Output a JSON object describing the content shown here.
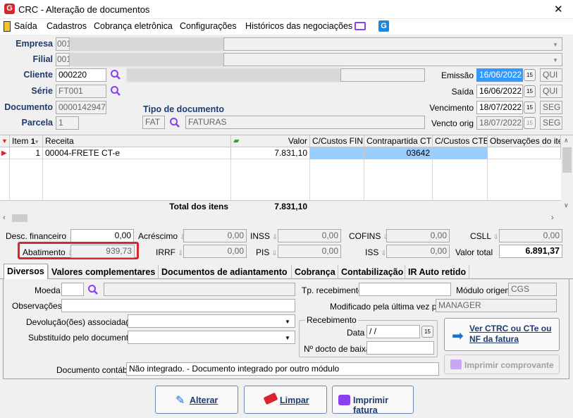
{
  "window": {
    "title": "CRC - Alteração de documentos",
    "close_glyph": "✕"
  },
  "menu": {
    "items": [
      "Saída",
      "Cadastros",
      "Cobrança eletrônica",
      "Configurações",
      "Históricos das negociações"
    ]
  },
  "header": {
    "empresa_label": "Empresa",
    "empresa_code": "001",
    "filial_label": "Filial",
    "filial_code": "001",
    "cliente_label": "Cliente",
    "cliente_code": "000220",
    "serie_label": "Série",
    "serie_value": "FT001",
    "documento_label": "Documento",
    "documento_value": "0000142947",
    "parcela_label": "Parcela",
    "parcela_value": "1",
    "tipo_label": "Tipo de documento",
    "tipo_code": "FAT",
    "tipo_desc": "FATURAS",
    "emissao_label": "Emissão",
    "emissao_date": "16/06/2022",
    "emissao_day": "QUI",
    "saida_label": "Saída",
    "saida_date": "16/06/2022",
    "saida_day": "QUI",
    "venc_label": "Vencimento",
    "venc_date": "18/07/2022",
    "venc_day": "SEG",
    "vencorig_label": "Vencto orig",
    "vencorig_date": "18/07/2022",
    "vencorig_day": "SEG"
  },
  "grid": {
    "columns": [
      "Item",
      "Receita",
      "Valor",
      "C/Custos FIN",
      "Contrapartida CTB",
      "C/Custos CTB",
      "Observações do item"
    ],
    "sort_marker": "1",
    "rows": [
      {
        "item": "1",
        "receita": "00004-FRETE CT-e",
        "valor": "7.831,10",
        "contrapartida": "03642"
      }
    ],
    "total_label": "Total dos itens",
    "total_value": "7.831,10"
  },
  "totals": {
    "desc_label": "Desc. financeiro",
    "desc_value": "0,00",
    "acresc_label": "Acréscimo",
    "acresc_value": "0,00",
    "inss_label": "INSS",
    "inss_value": "0,00",
    "cofins_label": "COFINS",
    "cofins_value": "0,00",
    "csll_label": "CSLL",
    "csll_value": "0,00",
    "abat_label": "Abatimento",
    "abat_value": "939,73",
    "irrf_label": "IRRF",
    "irrf_value": "0,00",
    "pis_label": "PIS",
    "pis_value": "0,00",
    "iss_label": "ISS",
    "iss_value": "0,00",
    "valortotal_label": "Valor total",
    "valortotal_value": "6.891,37"
  },
  "tabs": [
    "Diversos",
    "Valores complementares",
    "Documentos de adiantamento",
    "Cobrança",
    "Contabilização",
    "IR Auto retido"
  ],
  "diversos": {
    "moeda_label": "Moeda",
    "obs_label": "Observações",
    "devolucao_label": "Devolução(ões) associada(s)",
    "substituido_label": "Substituído pelo documento",
    "tprec_label": "Tp. recebimento",
    "modulo_label": "Módulo origem",
    "modulo_value": "CGS",
    "modificado_label": "Modificado pela última vez por",
    "modificado_value": "MANAGER",
    "recebimento_title": "Recebimento",
    "data_label": "Data",
    "data_value": " /  /",
    "ndocto_label": "Nº docto de baixa",
    "ver_btn": "Ver CTRC ou CTe ou NF da fatura",
    "imprimir_comp_btn": "Imprimir comprovante",
    "doccontabil_label": "Documento contábil",
    "doccontabil_value": "Não integrado.  - Documento integrado por outro módulo"
  },
  "actions": {
    "alterar": "Alterar",
    "limpar": "Limpar",
    "imprimir": "Imprimir fatura"
  },
  "colors": {
    "accent": "#1f3b6e",
    "highlight": "#3399ff",
    "annotation": "#d9262b",
    "search": "#8a3ff0"
  }
}
